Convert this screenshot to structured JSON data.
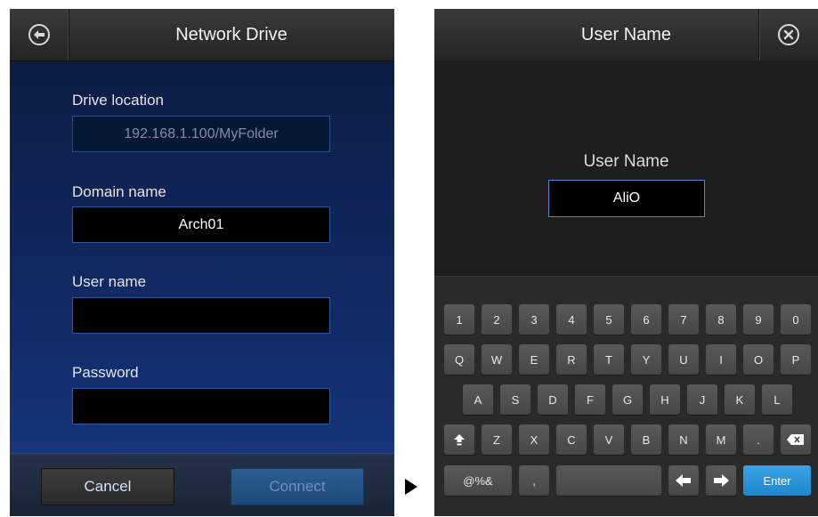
{
  "left": {
    "title": "Network Drive",
    "icons": {
      "back": "back-arrow-circle-icon"
    },
    "fields": {
      "drive_location": {
        "label": "Drive location",
        "value": "192.168.1.100/MyFolder"
      },
      "domain_name": {
        "label": "Domain name",
        "value": "Arch01"
      },
      "user_name": {
        "label": "User name",
        "value": ""
      },
      "password": {
        "label": "Password",
        "value": ""
      }
    },
    "buttons": {
      "cancel": "Cancel",
      "connect": "Connect"
    }
  },
  "right": {
    "title": "User Name",
    "icons": {
      "close": "close-circle-icon"
    },
    "entry": {
      "label": "User Name",
      "value": "AliO"
    },
    "keyboard": {
      "row1": [
        "1",
        "2",
        "3",
        "4",
        "5",
        "6",
        "7",
        "8",
        "9",
        "0"
      ],
      "row2": [
        "Q",
        "W",
        "E",
        "R",
        "T",
        "Y",
        "U",
        "I",
        "O",
        "P"
      ],
      "row3": [
        "A",
        "S",
        "D",
        "F",
        "G",
        "H",
        "J",
        "K",
        "L"
      ],
      "row4": [
        "⇑",
        "Z",
        "X",
        "C",
        "V",
        "B",
        "N",
        "M",
        "."
      ],
      "row5": {
        "symbols": "@%&",
        "comma": ",",
        "space": "",
        "enter": "Enter"
      }
    }
  },
  "colors": {
    "accent": "#2a8fd6",
    "field_border": "#2c5a9c",
    "header": "#2e2e2e"
  }
}
